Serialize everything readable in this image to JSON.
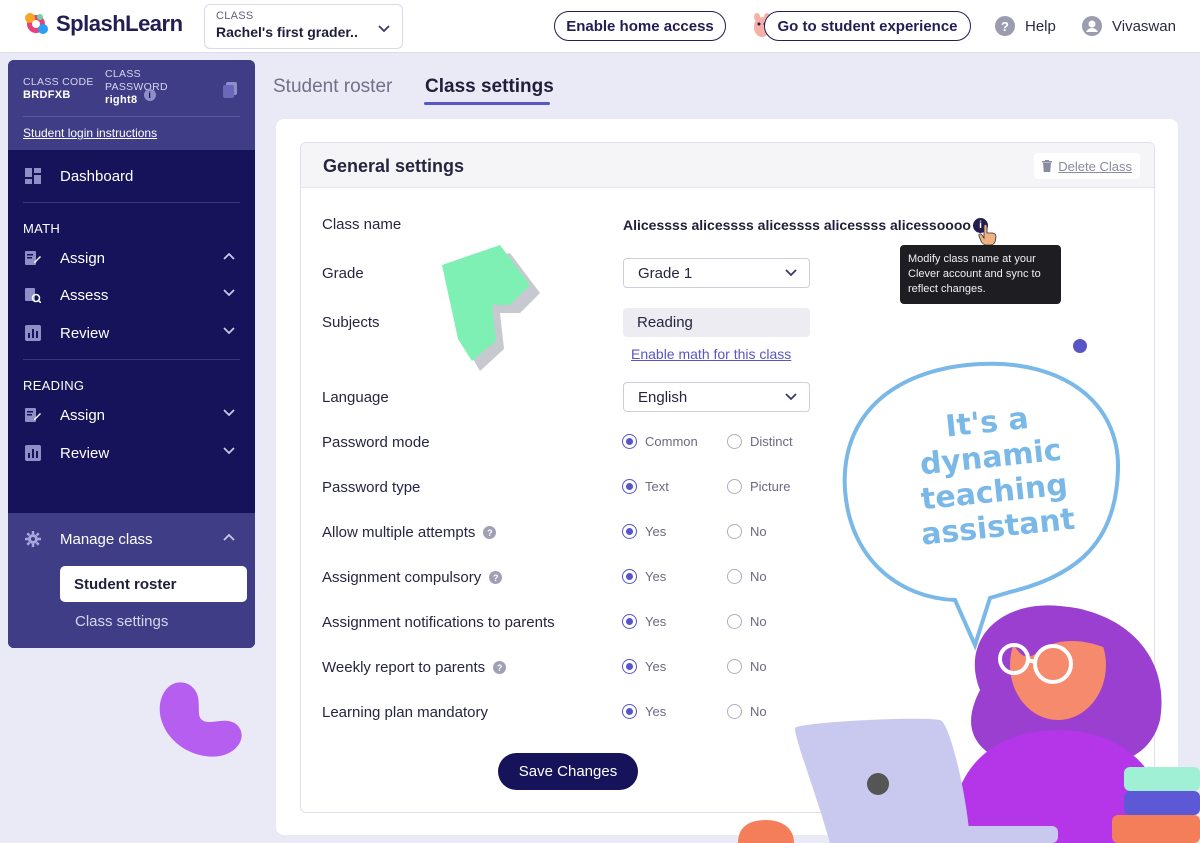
{
  "brand": {
    "name": "SplashLearn"
  },
  "header": {
    "class_label": "CLASS",
    "class_value": "Rachel's first grader..",
    "home_access": "Enable home access",
    "student_experience": "Go to student experience",
    "help": "Help",
    "user": "Vivaswan"
  },
  "sidebar": {
    "class_code_label": "CLASS CODE",
    "class_code": "BRDFXB",
    "class_password_label": "CLASS PASSWORD",
    "class_password": "right8",
    "login_instructions": "Student login instructions",
    "dashboard": "Dashboard",
    "math_section": "MATH",
    "math_assign": "Assign",
    "math_assess": "Assess",
    "math_review": "Review",
    "reading_section": "READING",
    "reading_assign": "Assign",
    "reading_review": "Review",
    "manage_class": "Manage class",
    "student_roster": "Student roster",
    "class_settings": "Class settings"
  },
  "tabs": {
    "roster": "Student roster",
    "settings": "Class settings"
  },
  "panel": {
    "title": "General settings",
    "delete": "Delete Class",
    "class_name_label": "Class name",
    "class_name_value": "Alicessss alicessss alicessss alicessss alicessoooo",
    "tooltip": "Modify class name at your Clever account and sync to reflect changes.",
    "grade_label": "Grade",
    "grade_value": "Grade 1",
    "subjects_label": "Subjects",
    "subject_value": "Reading",
    "enable_math": "Enable math for this class",
    "language_label": "Language",
    "language_value": "English",
    "password_mode_label": "Password mode",
    "password_mode_opts": [
      "Common",
      "Distinct"
    ],
    "password_type_label": "Password type",
    "password_type_opts": [
      "Text",
      "Picture"
    ],
    "multiple_attempts_label": "Allow multiple attempts",
    "compulsory_label": "Assignment compulsory",
    "notifications_label": "Assignment notifications to parents",
    "weekly_label": "Weekly report to parents",
    "learning_plan_label": "Learning plan mandatory",
    "yes": "Yes",
    "no": "No",
    "save": "Save Changes"
  },
  "illustration": {
    "bubble_text": "It's a dynamic teaching assistant"
  },
  "colors": {
    "navy": "#16135a",
    "accent": "#5755c8",
    "sidebar_light": "#3f3d86",
    "bubble": "#7ab8e8"
  }
}
